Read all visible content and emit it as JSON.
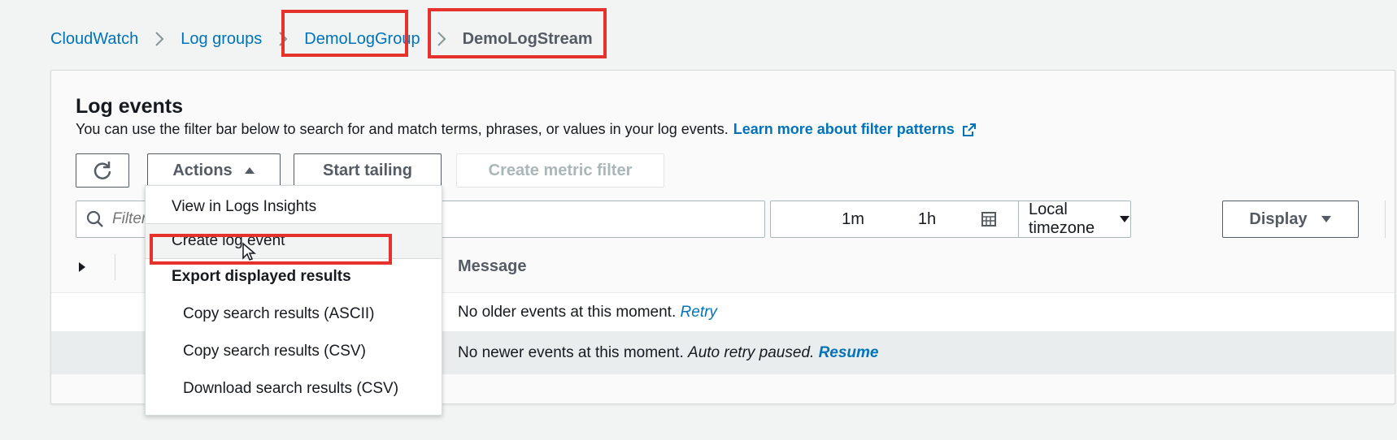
{
  "breadcrumb": {
    "items": [
      {
        "label": "CloudWatch"
      },
      {
        "label": "Log groups"
      },
      {
        "label": "DemoLogGroup"
      },
      {
        "label": "DemoLogStream"
      }
    ]
  },
  "panel": {
    "title": "Log events",
    "description": "You can use the filter bar below to search for and match terms, phrases, or values in your log events.",
    "learn_more": "Learn more about filter patterns"
  },
  "toolbar": {
    "actions_label": "Actions",
    "start_tailing_label": "Start tailing",
    "create_metric_filter_label": "Create metric filter"
  },
  "filter": {
    "placeholder": "Filter events"
  },
  "time_range": {
    "options": [
      "1m",
      "1h"
    ],
    "timezone": "Local timezone"
  },
  "display": {
    "label": "Display"
  },
  "table": {
    "message_header": "Message",
    "older_row": {
      "text": "No older events at this moment.",
      "link": "Retry"
    },
    "newer_row": {
      "text": "No newer events at this moment.",
      "paused": "Auto retry paused.",
      "link": "Resume"
    }
  },
  "actions_menu": {
    "items": [
      {
        "label": "View in Logs Insights"
      },
      {
        "label": "Create log event"
      },
      {
        "label": "Export displayed results"
      },
      {
        "label": "Copy search results (ASCII)"
      },
      {
        "label": "Copy search results (CSV)"
      },
      {
        "label": "Download search results (CSV)"
      }
    ]
  },
  "colors": {
    "link": "#0073bb",
    "highlight": "#e5322d",
    "text": "#16191f",
    "muted": "#545b64"
  },
  "icons": [
    "chevron-right-icon",
    "external-link-icon",
    "refresh-icon",
    "caret-up-icon",
    "search-icon",
    "calendar-icon",
    "caret-down-icon",
    "gear-icon",
    "expand-icon",
    "cursor-icon"
  ]
}
